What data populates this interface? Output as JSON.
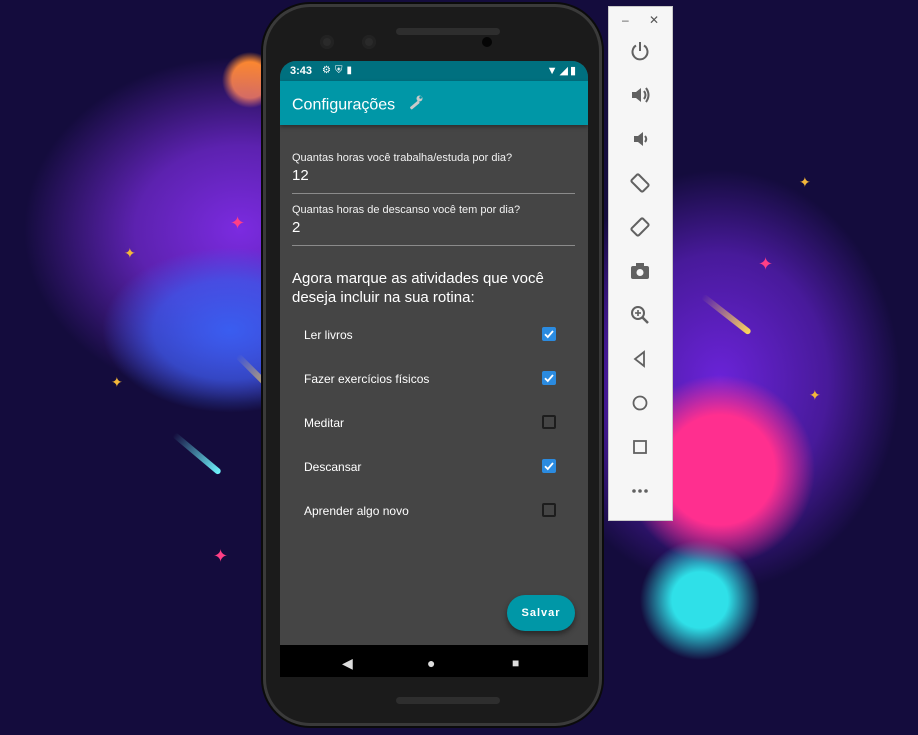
{
  "status_bar": {
    "time": "3:43",
    "icons": [
      "gear-icon",
      "shield-icon",
      "sim-icon"
    ],
    "right_icons": [
      "wifi-icon",
      "signal-icon",
      "battery-icon"
    ]
  },
  "app_bar": {
    "title": "Configurações"
  },
  "fields": [
    {
      "label": "Quantas horas você trabalha/estuda por dia?",
      "value": "12"
    },
    {
      "label": "Quantas horas de descanso você tem por dia?",
      "value": "2"
    }
  ],
  "prompt": "Agora marque as atividades que você deseja incluir na sua rotina:",
  "activities": [
    {
      "label": "Ler livros",
      "checked": true
    },
    {
      "label": "Fazer exercícios físicos",
      "checked": true
    },
    {
      "label": "Meditar",
      "checked": false
    },
    {
      "label": "Descansar",
      "checked": true
    },
    {
      "label": "Aprender algo novo",
      "checked": false
    }
  ],
  "save_button": {
    "label": "Salvar"
  },
  "nav": {
    "back": "◀",
    "home": "●",
    "recents": "■"
  },
  "emulator_panel": {
    "minimize": "–",
    "close": "✕",
    "buttons": [
      "power-icon",
      "volume-up-icon",
      "volume-down-icon",
      "rotate-left-icon",
      "rotate-right-icon",
      "camera-icon",
      "zoom-icon",
      "back-icon",
      "home-icon",
      "overview-icon",
      "more-icon"
    ]
  },
  "colors": {
    "accent": "#0097a7",
    "status": "#00707f",
    "checkbox": "#2b8be0",
    "background": "#454545"
  }
}
